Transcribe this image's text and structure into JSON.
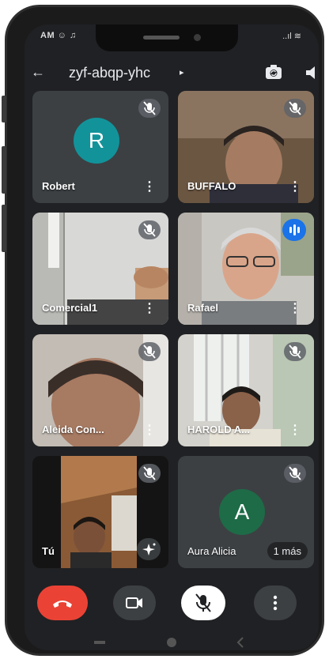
{
  "status_bar": {
    "left": "AM ☺ ♫",
    "right": "..ıl ≋"
  },
  "header": {
    "back_glyph": "←",
    "room_code": "zyf-abqp-yhc",
    "room_chevron": "▸"
  },
  "participants": [
    {
      "name": "Robert",
      "avatar_letter": "R",
      "avatar_color": "#12939a",
      "muted": true
    },
    {
      "name": "BUFFALO",
      "muted": true
    },
    {
      "name": "Comercial1",
      "muted": true
    },
    {
      "name": "Rafael",
      "speaking": true
    },
    {
      "name": "Aleida Con...",
      "muted": true
    },
    {
      "name": "HAROLD A...",
      "muted": true
    },
    {
      "name": "Tú",
      "muted": true,
      "is_self": true
    },
    {
      "name": "Aura Alicia",
      "avatar_letter": "A",
      "avatar_color": "#1e6b47",
      "muted": true,
      "more_label": "1 más"
    }
  ],
  "menu_glyph": "⋮",
  "controls": {
    "end_call_color": "#ea4335",
    "camera_bg": "#3c4043",
    "mic_bg": "#ffffff",
    "more_bg": "#3c4043"
  },
  "colors": {
    "background": "#202124",
    "tile": "#3c4043",
    "accent": "#1a73e8"
  }
}
